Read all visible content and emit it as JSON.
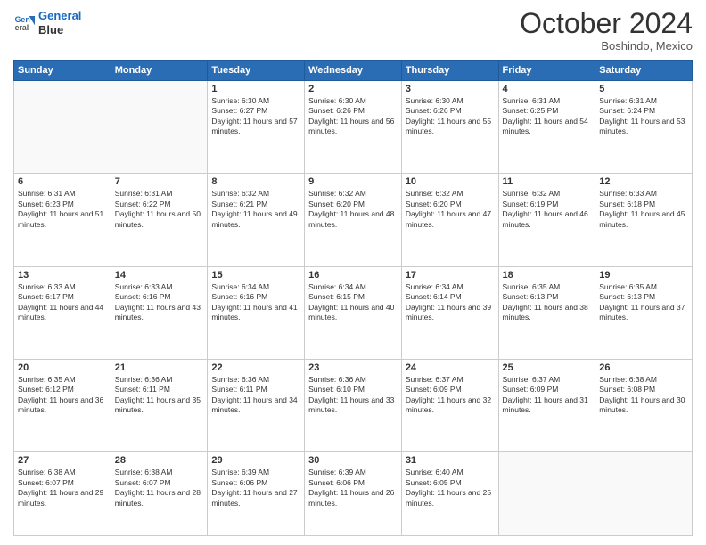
{
  "header": {
    "logo_line1": "General",
    "logo_line2": "Blue",
    "month": "October 2024",
    "location": "Boshindo, Mexico"
  },
  "weekdays": [
    "Sunday",
    "Monday",
    "Tuesday",
    "Wednesday",
    "Thursday",
    "Friday",
    "Saturday"
  ],
  "weeks": [
    [
      {
        "day": null
      },
      {
        "day": null
      },
      {
        "day": "1",
        "sunrise": "6:30 AM",
        "sunset": "6:27 PM",
        "daylight": "11 hours and 57 minutes."
      },
      {
        "day": "2",
        "sunrise": "6:30 AM",
        "sunset": "6:26 PM",
        "daylight": "11 hours and 56 minutes."
      },
      {
        "day": "3",
        "sunrise": "6:30 AM",
        "sunset": "6:26 PM",
        "daylight": "11 hours and 55 minutes."
      },
      {
        "day": "4",
        "sunrise": "6:31 AM",
        "sunset": "6:25 PM",
        "daylight": "11 hours and 54 minutes."
      },
      {
        "day": "5",
        "sunrise": "6:31 AM",
        "sunset": "6:24 PM",
        "daylight": "11 hours and 53 minutes."
      }
    ],
    [
      {
        "day": "6",
        "sunrise": "6:31 AM",
        "sunset": "6:23 PM",
        "daylight": "11 hours and 51 minutes."
      },
      {
        "day": "7",
        "sunrise": "6:31 AM",
        "sunset": "6:22 PM",
        "daylight": "11 hours and 50 minutes."
      },
      {
        "day": "8",
        "sunrise": "6:32 AM",
        "sunset": "6:21 PM",
        "daylight": "11 hours and 49 minutes."
      },
      {
        "day": "9",
        "sunrise": "6:32 AM",
        "sunset": "6:20 PM",
        "daylight": "11 hours and 48 minutes."
      },
      {
        "day": "10",
        "sunrise": "6:32 AM",
        "sunset": "6:20 PM",
        "daylight": "11 hours and 47 minutes."
      },
      {
        "day": "11",
        "sunrise": "6:32 AM",
        "sunset": "6:19 PM",
        "daylight": "11 hours and 46 minutes."
      },
      {
        "day": "12",
        "sunrise": "6:33 AM",
        "sunset": "6:18 PM",
        "daylight": "11 hours and 45 minutes."
      }
    ],
    [
      {
        "day": "13",
        "sunrise": "6:33 AM",
        "sunset": "6:17 PM",
        "daylight": "11 hours and 44 minutes."
      },
      {
        "day": "14",
        "sunrise": "6:33 AM",
        "sunset": "6:16 PM",
        "daylight": "11 hours and 43 minutes."
      },
      {
        "day": "15",
        "sunrise": "6:34 AM",
        "sunset": "6:16 PM",
        "daylight": "11 hours and 41 minutes."
      },
      {
        "day": "16",
        "sunrise": "6:34 AM",
        "sunset": "6:15 PM",
        "daylight": "11 hours and 40 minutes."
      },
      {
        "day": "17",
        "sunrise": "6:34 AM",
        "sunset": "6:14 PM",
        "daylight": "11 hours and 39 minutes."
      },
      {
        "day": "18",
        "sunrise": "6:35 AM",
        "sunset": "6:13 PM",
        "daylight": "11 hours and 38 minutes."
      },
      {
        "day": "19",
        "sunrise": "6:35 AM",
        "sunset": "6:13 PM",
        "daylight": "11 hours and 37 minutes."
      }
    ],
    [
      {
        "day": "20",
        "sunrise": "6:35 AM",
        "sunset": "6:12 PM",
        "daylight": "11 hours and 36 minutes."
      },
      {
        "day": "21",
        "sunrise": "6:36 AM",
        "sunset": "6:11 PM",
        "daylight": "11 hours and 35 minutes."
      },
      {
        "day": "22",
        "sunrise": "6:36 AM",
        "sunset": "6:11 PM",
        "daylight": "11 hours and 34 minutes."
      },
      {
        "day": "23",
        "sunrise": "6:36 AM",
        "sunset": "6:10 PM",
        "daylight": "11 hours and 33 minutes."
      },
      {
        "day": "24",
        "sunrise": "6:37 AM",
        "sunset": "6:09 PM",
        "daylight": "11 hours and 32 minutes."
      },
      {
        "day": "25",
        "sunrise": "6:37 AM",
        "sunset": "6:09 PM",
        "daylight": "11 hours and 31 minutes."
      },
      {
        "day": "26",
        "sunrise": "6:38 AM",
        "sunset": "6:08 PM",
        "daylight": "11 hours and 30 minutes."
      }
    ],
    [
      {
        "day": "27",
        "sunrise": "6:38 AM",
        "sunset": "6:07 PM",
        "daylight": "11 hours and 29 minutes."
      },
      {
        "day": "28",
        "sunrise": "6:38 AM",
        "sunset": "6:07 PM",
        "daylight": "11 hours and 28 minutes."
      },
      {
        "day": "29",
        "sunrise": "6:39 AM",
        "sunset": "6:06 PM",
        "daylight": "11 hours and 27 minutes."
      },
      {
        "day": "30",
        "sunrise": "6:39 AM",
        "sunset": "6:06 PM",
        "daylight": "11 hours and 26 minutes."
      },
      {
        "day": "31",
        "sunrise": "6:40 AM",
        "sunset": "6:05 PM",
        "daylight": "11 hours and 25 minutes."
      },
      {
        "day": null
      },
      {
        "day": null
      }
    ]
  ],
  "labels": {
    "sunrise": "Sunrise:",
    "sunset": "Sunset:",
    "daylight": "Daylight:"
  }
}
